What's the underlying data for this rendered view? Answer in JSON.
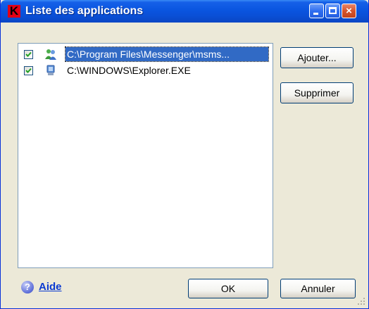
{
  "window": {
    "title": "Liste des applications",
    "app_icon_letter": "K"
  },
  "titlebar_buttons": {
    "minimize": "minimize",
    "maximize": "maximize",
    "close": "×"
  },
  "applications": [
    {
      "checked": true,
      "icon": "messenger-users-icon",
      "path": "C:\\Program Files\\Messenger\\msms...",
      "selected": true
    },
    {
      "checked": true,
      "icon": "computer-monitor-icon",
      "path": "C:\\WINDOWS\\Explorer.EXE",
      "selected": false
    }
  ],
  "buttons": {
    "add": "Ajouter...",
    "remove": "Supprimer",
    "ok": "OK",
    "cancel": "Annuler"
  },
  "help": {
    "icon": "?",
    "label": "Aide"
  },
  "colors": {
    "titlebar": "#0a55e0",
    "dialog_bg": "#ece9d8",
    "selection": "#316ac5",
    "link": "#0a3ad1"
  }
}
